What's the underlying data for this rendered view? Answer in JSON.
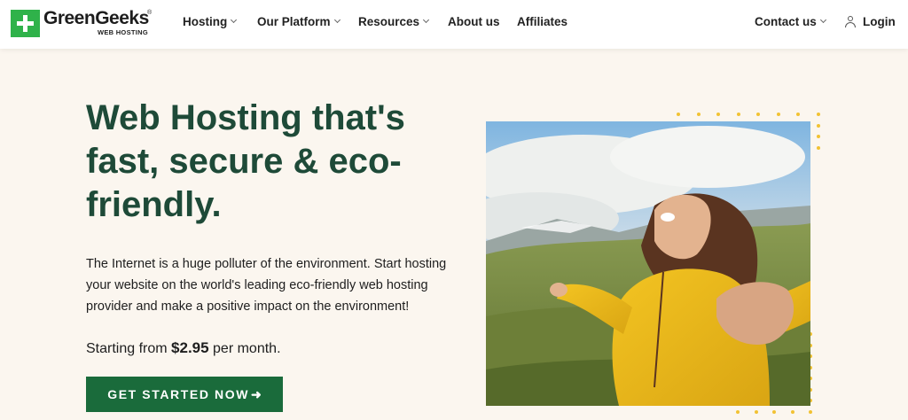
{
  "brand": {
    "name": "GreenGeeks",
    "registered": "®",
    "tagline": "WEB HOSTING",
    "color_primary": "#2fb24a",
    "color_heading": "#1e4a38",
    "color_cta": "#1a6b3b",
    "color_dots": "#f2c233"
  },
  "nav": {
    "hosting": "Hosting",
    "platform": "Our Platform",
    "resources": "Resources",
    "about": "About us",
    "affiliates": "Affiliates",
    "contact": "Contact us",
    "login": "Login"
  },
  "hero": {
    "title_line1": "Web Hosting that's",
    "title_line2": "fast, secure & eco-",
    "title_line3": "friendly.",
    "description": "The Internet is a huge polluter of the environment. Start hosting your website on the world's leading eco-friendly web hosting provider and make a positive impact on the environment!",
    "price_prefix": "Starting from ",
    "price": "$2.95",
    "price_suffix": " per month.",
    "cta_label": "GET STARTED NOW",
    "cta_icon": "arrow-right-icon"
  }
}
